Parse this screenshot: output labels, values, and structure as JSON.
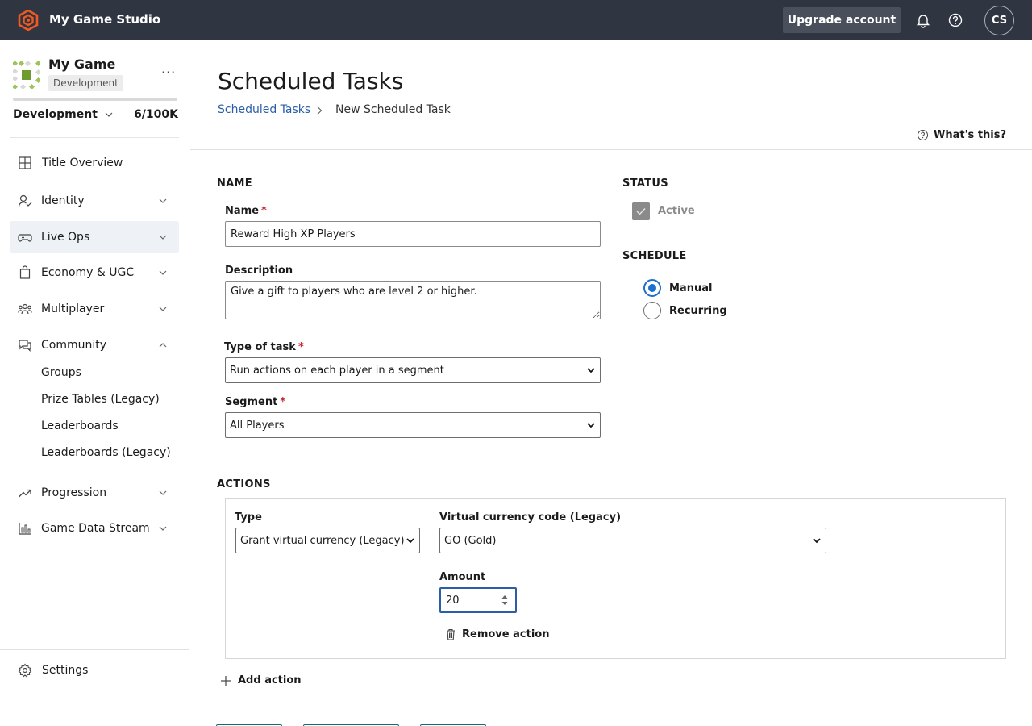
{
  "topbar": {
    "studio_name": "My Game Studio",
    "upgrade_label": "Upgrade account",
    "avatar_initials": "CS",
    "accent": "#f05a22"
  },
  "sidebar": {
    "game_name": "My Game",
    "env_badge": "Development",
    "env_select": "Development",
    "usage": "6/100K",
    "items": [
      {
        "label": "Title Overview",
        "icon": "grid-icon"
      },
      {
        "label": "Identity",
        "icon": "identity-icon"
      },
      {
        "label": "Live Ops",
        "icon": "gamepad-icon"
      },
      {
        "label": "Economy & UGC",
        "icon": "shopping-bag-icon"
      },
      {
        "label": "Multiplayer",
        "icon": "people-icon"
      },
      {
        "label": "Community",
        "icon": "chat-icon"
      },
      {
        "label": "Progression",
        "icon": "trend-icon"
      },
      {
        "label": "Game Data Stream",
        "icon": "bar-chart-icon"
      }
    ],
    "community_subitems": [
      "Groups",
      "Prize Tables (Legacy)",
      "Leaderboards",
      "Leaderboards (Legacy)"
    ],
    "settings_label": "Settings"
  },
  "page": {
    "title": "Scheduled Tasks",
    "breadcrumb_link": "Scheduled Tasks",
    "breadcrumb_current": "New Scheduled Task",
    "whats_this": "What's this?"
  },
  "form": {
    "name_section": "NAME",
    "name_label": "Name",
    "name_value": "Reward High XP Players",
    "description_label": "Description",
    "description_value": "Give a gift to players who are level 2 or higher.",
    "type_label": "Type of task",
    "type_value": "Run actions on each player in a segment",
    "segment_label": "Segment",
    "segment_value": "All Players",
    "required_mark": "*",
    "status_section": "STATUS",
    "active_label": "Active",
    "schedule_section": "SCHEDULE",
    "manual_label": "Manual",
    "recurring_label": "Recurring"
  },
  "actions": {
    "section": "ACTIONS",
    "type_label": "Type",
    "type_value": "Grant virtual currency (Legacy)",
    "currency_label": "Virtual currency code (Legacy)",
    "currency_value": "GO (Gold)",
    "amount_label": "Amount",
    "amount_value": "20",
    "remove_label": "Remove action",
    "add_label": "Add action"
  }
}
